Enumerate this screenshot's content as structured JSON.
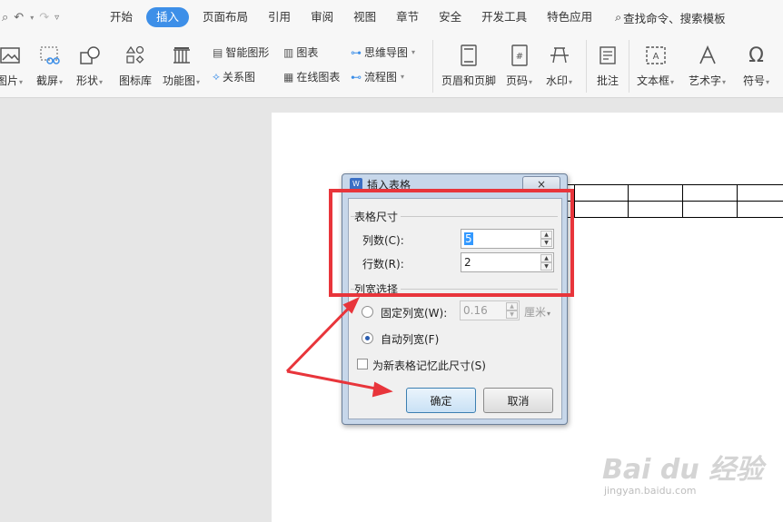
{
  "menubar": {
    "tabs": [
      "开始",
      "插入",
      "页面布局",
      "引用",
      "审阅",
      "视图",
      "章节",
      "安全",
      "开发工具",
      "特色应用"
    ],
    "active_tab": "插入",
    "search": "查找命令、搜索模板"
  },
  "ribbon": {
    "picture": "图片",
    "screenshot": "截屏",
    "shapes": "形状",
    "icon_library": "图标库",
    "function_chart": "功能图",
    "smart_graphic": "智能图形",
    "chart": "图表",
    "mind_map": "思维导图",
    "relation_chart": "关系图",
    "online_chart": "在线图表",
    "flowchart": "流程图",
    "header_footer": "页眉和页脚",
    "page_number": "页码",
    "watermark": "水印",
    "comment": "批注",
    "text_box": "文本框",
    "word_art": "艺术字",
    "symbol": "符号"
  },
  "dialog": {
    "title": "插入表格",
    "size_group": "表格尺寸",
    "columns_label": "列数(C):",
    "columns_value": "5",
    "rows_label": "行数(R):",
    "rows_value": "2",
    "width_group": "列宽选择",
    "fixed_width_label": "固定列宽(W):",
    "fixed_width_value": "0.16",
    "unit": "厘米",
    "auto_width_label": "自动列宽(F)",
    "auto_width_selected": true,
    "remember_label": "为新表格记忆此尺寸(S)",
    "ok": "确定",
    "cancel": "取消",
    "close": "×"
  },
  "watermark_text": {
    "main": "Bai du 经验",
    "sub": "jingyan.baidu.com"
  },
  "colors": {
    "active_tab": "#3d8fe8",
    "annotation": "#e8353b",
    "dialog_frame": "#c7d7ea"
  }
}
